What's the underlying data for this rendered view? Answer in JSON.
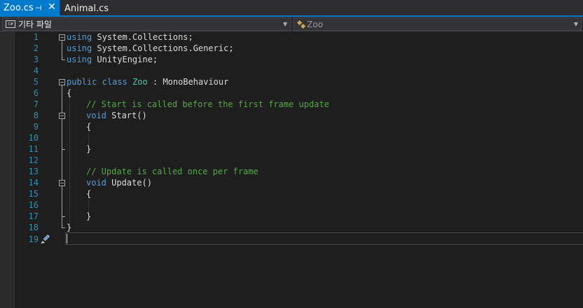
{
  "tabs": [
    {
      "label": "Zoo.cs",
      "active": true
    },
    {
      "label": "Animal.cs",
      "active": false
    }
  ],
  "tab_pin_glyph": "⊣",
  "tab_close_glyph": "✕",
  "navbar": {
    "project_icon_text": "C#",
    "project_label": "기타 파일",
    "class_label": "Zoo"
  },
  "editor": {
    "line_numbers": [
      "1",
      "2",
      "3",
      "4",
      "5",
      "6",
      "7",
      "8",
      "9",
      "10",
      "11",
      "12",
      "13",
      "14",
      "15",
      "16",
      "17",
      "18",
      "19"
    ],
    "lines": {
      "l1_kw": "using",
      "l1_rest": " System.Collections;",
      "l2_kw": "using",
      "l2_rest": " System.Collections.Generic;",
      "l3_kw": "using",
      "l3_rest": " UnityEngine;",
      "l5_kw1": "public",
      "l5_kw2": "class",
      "l5_type": "Zoo",
      "l5_rest": " : MonoBehaviour",
      "l6": "{",
      "l7_comment": "// Start is called before the first frame update",
      "l8_kw": "void",
      "l8_rest": " Start()",
      "l9": "{",
      "l11": "}",
      "l13_comment": "// Update is called once per frame",
      "l14_kw": "void",
      "l14_rest": " Update()",
      "l15": "{",
      "l17": "}",
      "l18": "}"
    }
  },
  "colors": {
    "accent": "#007acc",
    "keyword": "#569cd6",
    "type": "#4ec9b0",
    "comment": "#57a64a",
    "line_number": "#2b91af"
  }
}
